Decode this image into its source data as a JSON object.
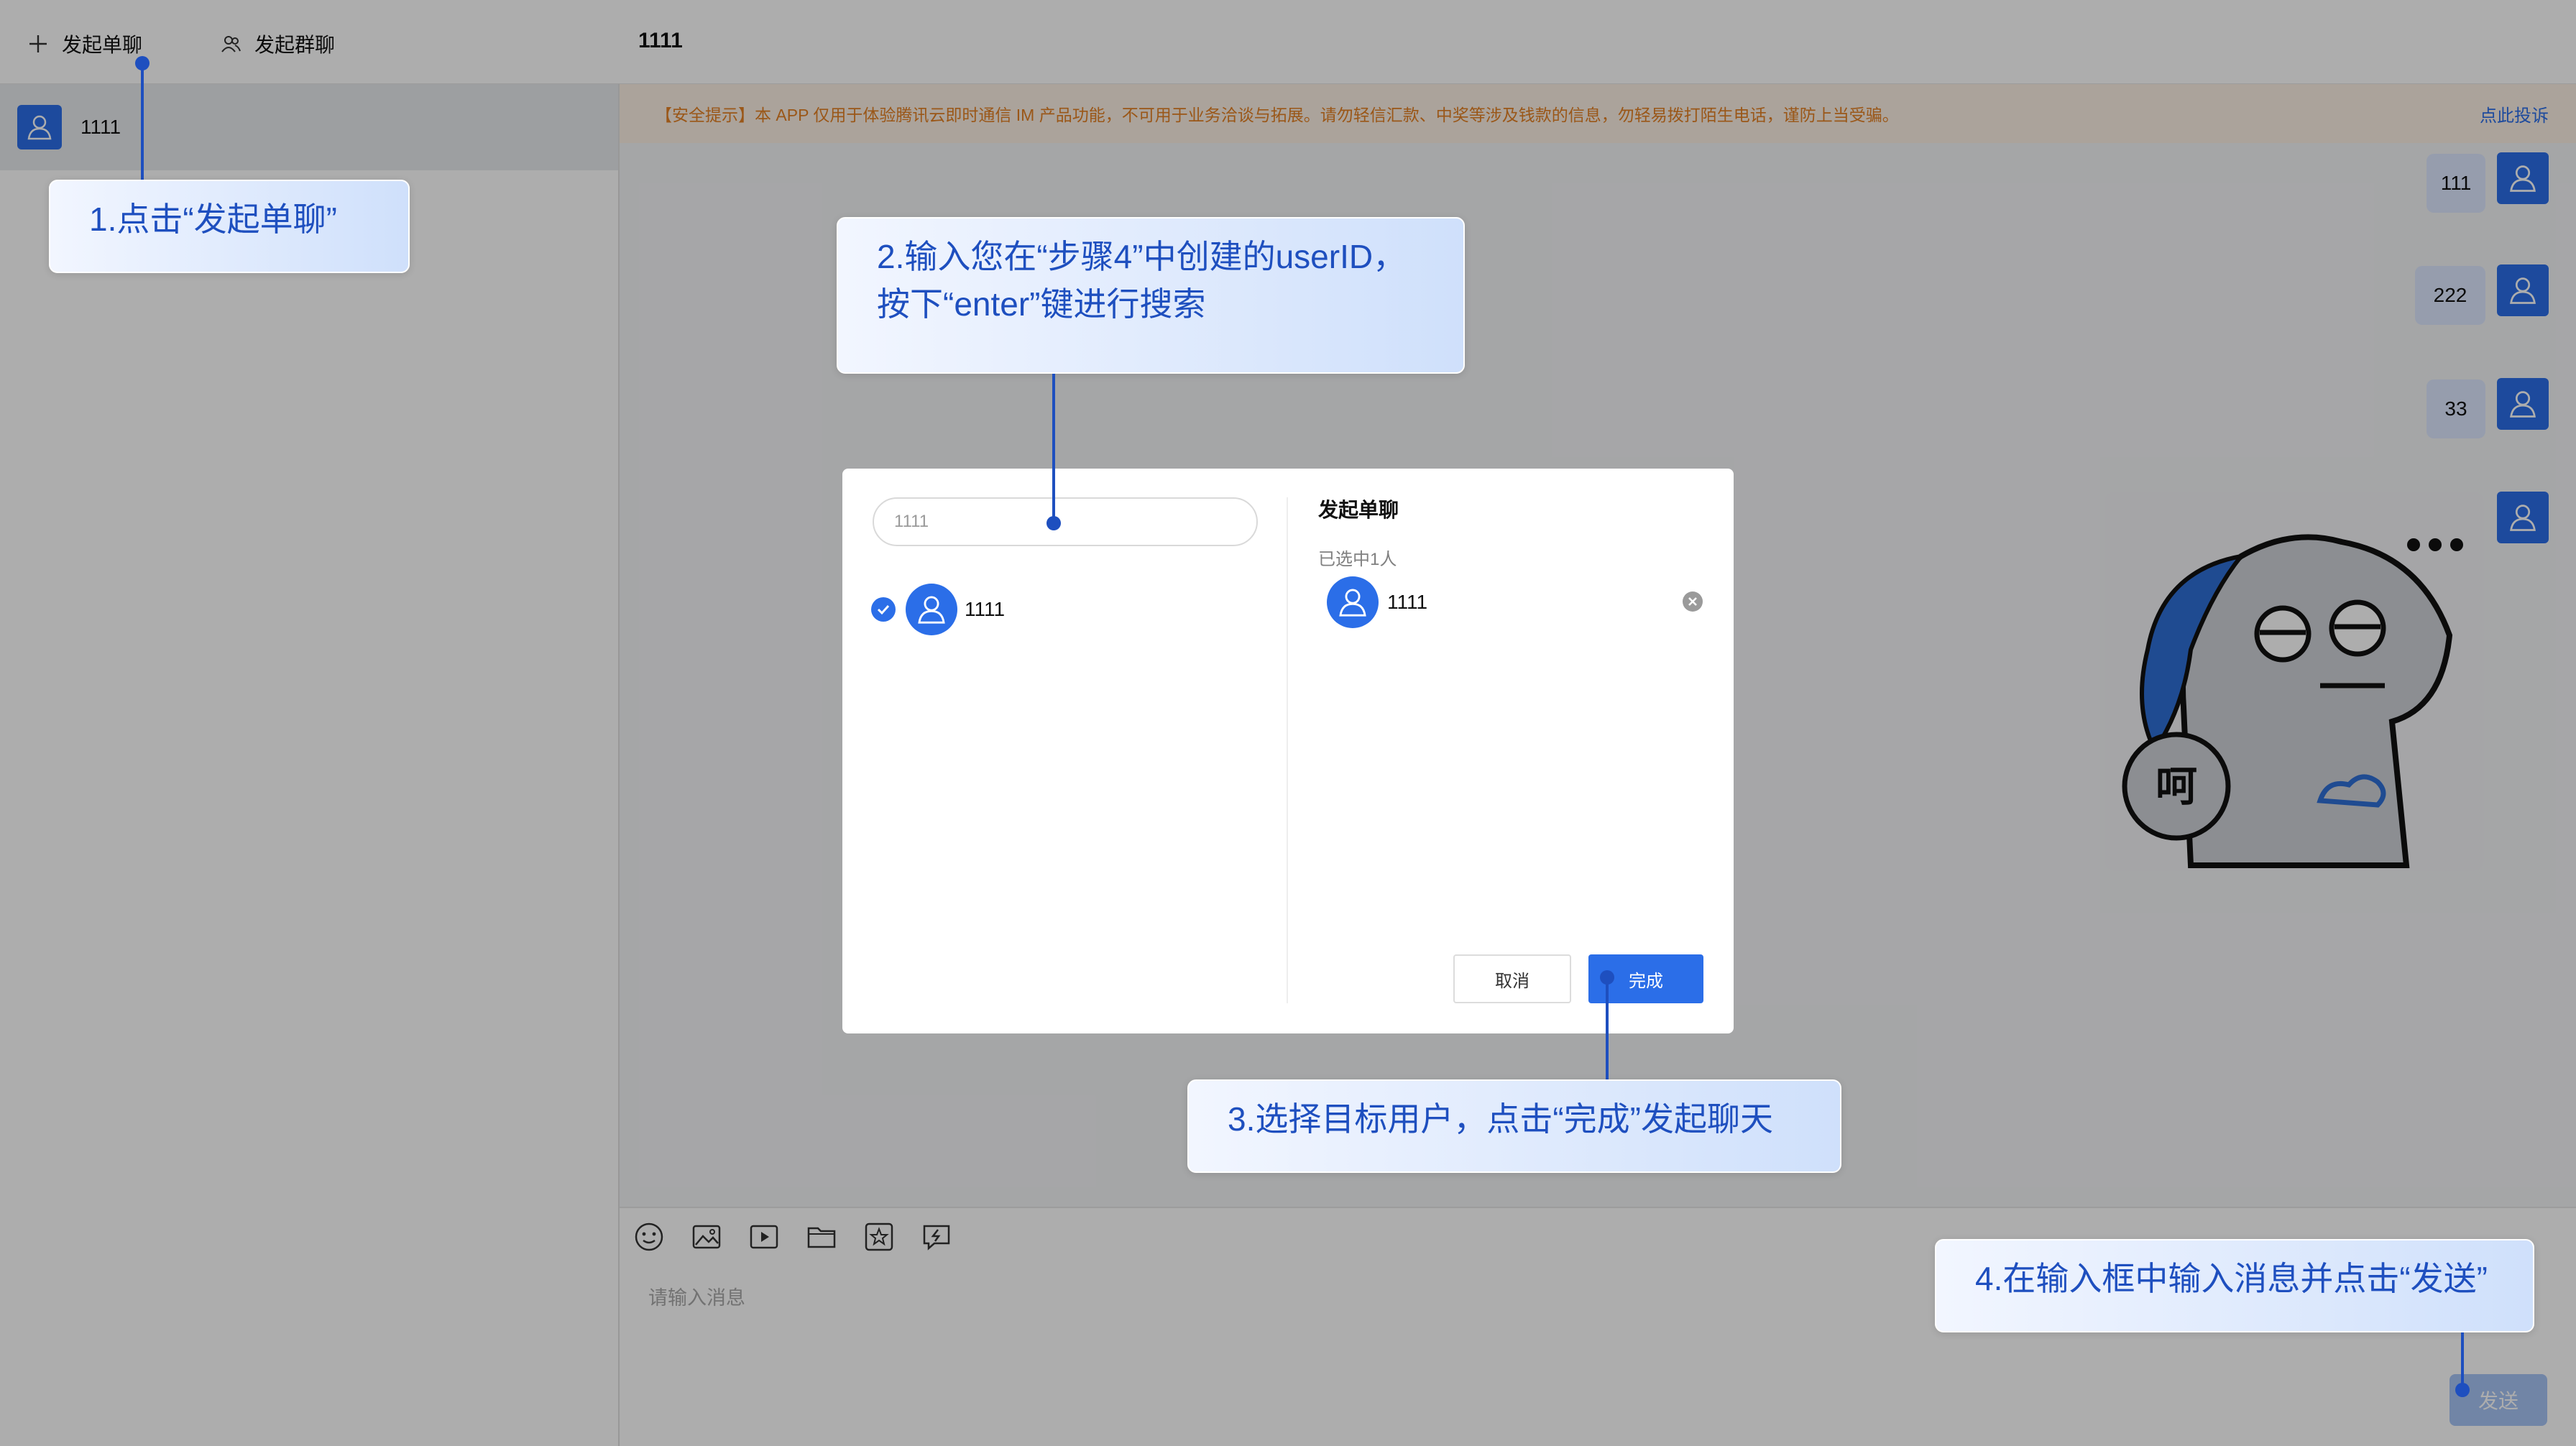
{
  "sidebar": {
    "new_single_chat": "发起单聊",
    "new_group_chat": "发起群聊",
    "conversations": [
      {
        "name": "1111"
      }
    ]
  },
  "chat": {
    "title": "1111",
    "notice": "【安全提示】本 APP 仅用于体验腾讯云即时通信 IM 产品功能，不可用于业务洽谈与拓展。请勿轻信汇款、中奖等涉及钱款的信息，勿轻易拨打陌生电话，谨防上当受骗。",
    "notice_link": "点此投诉",
    "messages": [
      {
        "text": "111"
      },
      {
        "text": "222"
      },
      {
        "text": "33"
      },
      {
        "type": "sticker",
        "caption": "呵"
      }
    ],
    "input_placeholder": "请输入消息",
    "send_label": "发送",
    "toolbar_icons": [
      "emoji-icon",
      "image-icon",
      "video-icon",
      "folder-icon",
      "star-icon",
      "quick-reply-icon"
    ]
  },
  "dialog": {
    "search_value": "1111",
    "results": [
      {
        "name": "1111",
        "checked": true
      }
    ],
    "title": "发起单聊",
    "selected_count": "已选中1人",
    "selected": [
      {
        "name": "1111"
      }
    ],
    "cancel_label": "取消",
    "done_label": "完成"
  },
  "annotations": {
    "step1": "1.点击“发起单聊”",
    "step2_line1": "2.输入您在“步骤4”中创建的userID，",
    "step2_line2": "按下“enter”键进行搜索",
    "step3": "3.选择目标用户，点击“完成”发起聊天",
    "step4": "4.在输入框中输入消息并点击“发送”"
  },
  "colors": {
    "accent": "#2b6ee8",
    "annotation": "#1e4fbf",
    "notice_text": "#e48024",
    "notice_bg": "#fdf0e5"
  }
}
